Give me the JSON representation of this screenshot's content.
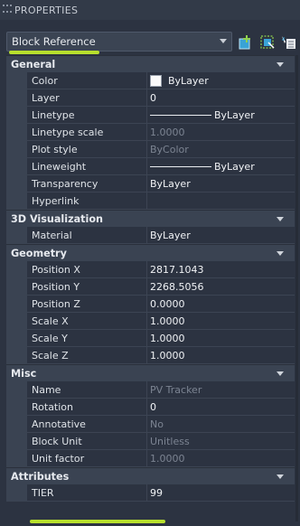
{
  "palette": {
    "title": "PROPERTIES"
  },
  "selector": {
    "value": "Block Reference"
  },
  "toolbar": {
    "quick_select_icon": "quick-select-icon",
    "select_objects_icon": "select-objects-icon",
    "toggle_pickadd_icon": "toggle-pickadd-icon"
  },
  "accent_color": "#b7df2d",
  "categories": {
    "general": {
      "title": "General",
      "color": {
        "label": "Color",
        "value": "ByLayer"
      },
      "layer": {
        "label": "Layer",
        "value": "0"
      },
      "linetype": {
        "label": "Linetype",
        "value": "ByLayer"
      },
      "linetype_scale": {
        "label": "Linetype scale",
        "value": "1.0000"
      },
      "plot_style": {
        "label": "Plot style",
        "value": "ByColor"
      },
      "lineweight": {
        "label": "Lineweight",
        "value": "ByLayer"
      },
      "transparency": {
        "label": "Transparency",
        "value": "ByLayer"
      },
      "hyperlink": {
        "label": "Hyperlink",
        "value": ""
      }
    },
    "visualization": {
      "title": "3D Visualization",
      "material": {
        "label": "Material",
        "value": "ByLayer"
      }
    },
    "geometry": {
      "title": "Geometry",
      "position_x": {
        "label": "Position X",
        "value": "2817.1043"
      },
      "position_y": {
        "label": "Position Y",
        "value": "2268.5056"
      },
      "position_z": {
        "label": "Position Z",
        "value": "0.0000"
      },
      "scale_x": {
        "label": "Scale X",
        "value": "1.0000"
      },
      "scale_y": {
        "label": "Scale Y",
        "value": "1.0000"
      },
      "scale_z": {
        "label": "Scale Z",
        "value": "1.0000"
      }
    },
    "misc": {
      "title": "Misc",
      "name": {
        "label": "Name",
        "value": "PV Tracker"
      },
      "rotation": {
        "label": "Rotation",
        "value": "0"
      },
      "annotative": {
        "label": "Annotative",
        "value": "No"
      },
      "block_unit": {
        "label": "Block Unit",
        "value": "Unitless"
      },
      "unit_factor": {
        "label": "Unit factor",
        "value": "1.0000"
      }
    },
    "attributes": {
      "title": "Attributes",
      "tier": {
        "label": "TIER",
        "value": "99"
      }
    }
  }
}
